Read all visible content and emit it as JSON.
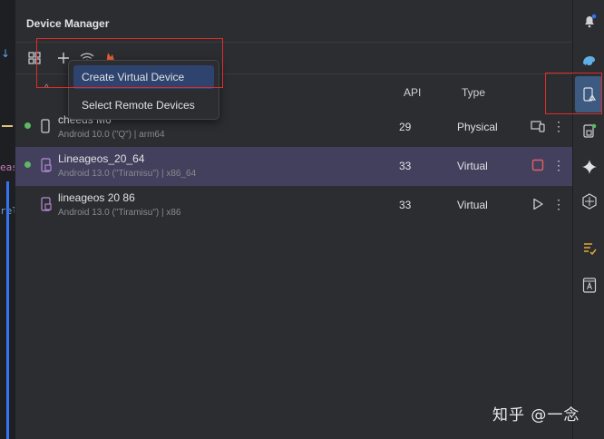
{
  "panel": {
    "title": "Device Manager"
  },
  "editor_snips": [
    "eas",
    "rel"
  ],
  "toolbar": {
    "icons": [
      "layout-icon",
      "add-icon",
      "wifi-icon",
      "firebase-icon"
    ]
  },
  "popup_menu": {
    "items": [
      {
        "label": "Create Virtual Device"
      },
      {
        "label": "Select Remote Devices"
      }
    ]
  },
  "columns": {
    "api": "API",
    "type": "Type"
  },
  "devices": [
    {
      "name": "cheeus M6",
      "subtitle": "Android 10.0 (\"Q\") | arm64",
      "api": "29",
      "type": "Physical",
      "online": true,
      "kind": "phone",
      "action": "mirror-icon"
    },
    {
      "name": "Lineageos_20_64",
      "subtitle": "Android 13.0 (\"Tiramisu\") | x86_64",
      "api": "33",
      "type": "Virtual",
      "online": true,
      "kind": "emulator",
      "action": "stop-icon"
    },
    {
      "name": "lineageos 20 86",
      "subtitle": "Android 13.0 (\"Tiramisu\") | x86",
      "api": "33",
      "type": "Virtual",
      "online": false,
      "kind": "emulator",
      "action": "play-icon"
    }
  ],
  "more_glyph": "⋮",
  "watermark": "知乎 @一念",
  "colors": {
    "selected_row": "#43405d",
    "online_dot": "#5fb865",
    "stop": "#e06060",
    "accent": "#3574f0",
    "annotation": "#e02b2b"
  }
}
